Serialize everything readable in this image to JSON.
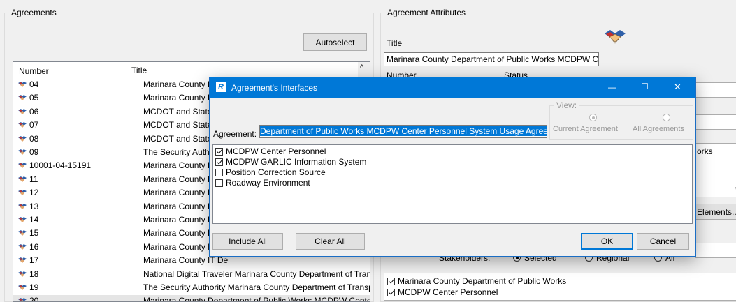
{
  "agreements": {
    "group_label": "Agreements",
    "autoselect_label": "Autoselect",
    "columns": {
      "number": "Number",
      "title": "Title"
    },
    "rows": [
      {
        "number": "04",
        "title": "Marinara County Depa"
      },
      {
        "number": "05",
        "title": "Marinara County Depa"
      },
      {
        "number": "06",
        "title": "MCDOT and State High"
      },
      {
        "number": "07",
        "title": "MCDOT and State High"
      },
      {
        "number": "08",
        "title": "MCDOT and State High"
      },
      {
        "number": "09",
        "title": "The Security Authority"
      },
      {
        "number": "10001-04-15191",
        "title": "Marinara County FMC"
      },
      {
        "number": "11",
        "title": "Marinara County Depa"
      },
      {
        "number": "12",
        "title": "Marinara County Depa"
      },
      {
        "number": "13",
        "title": "Marinara County Depa"
      },
      {
        "number": "14",
        "title": "Marinara County Depa"
      },
      {
        "number": "15",
        "title": "Marinara County Depa"
      },
      {
        "number": "16",
        "title": "Marinara County IT De"
      },
      {
        "number": "17",
        "title": "Marinara County IT De"
      },
      {
        "number": "18",
        "title": "National Digital Traveler Marinara County Department of Transpor"
      },
      {
        "number": "19",
        "title": "The Security Authority Marinara County Department of Transporta"
      },
      {
        "number": "20",
        "title": "Marinara County Department of Public Works MCDPW Center Pers"
      }
    ]
  },
  "attributes": {
    "group_label": "Agreement Attributes",
    "title_label": "Title",
    "title_value": "Marinara County Department of Public Works MCDPW Center",
    "number_label": "Number",
    "status_label": "Status",
    "elements_button": "Elements...",
    "partial_text": "orks",
    "stakeholders_label": "Stakeholders:",
    "selected_label": "Selected",
    "regional_label": "Regional",
    "all_label": "All",
    "stakeholder_items": [
      {
        "label": "Marinara County Department of Public Works",
        "checked": true
      },
      {
        "label": "MCDPW Center Personnel",
        "checked": true
      }
    ]
  },
  "dialog": {
    "title": "Agreement's Interfaces",
    "agreement_label": "Agreement:",
    "agreement_value": " Department of Public Works MCDPW Center Personnel System Usage Agreement",
    "view_label": "View:",
    "view_current": "Current Agreement",
    "view_all": "All Agreements",
    "interfaces": [
      {
        "label": "MCDPW Center Personnel",
        "checked": true
      },
      {
        "label": "MCDPW GARLIC Information System",
        "checked": true
      },
      {
        "label": "Position Correction Source",
        "checked": false
      },
      {
        "label": "Roadway Environment",
        "checked": false
      }
    ],
    "include_all": "Include All",
    "clear_all": "Clear All",
    "ok": "OK",
    "cancel": "Cancel",
    "minimize_glyph": "—",
    "maximize_glyph": "☐",
    "close_glyph": "✕",
    "app_icon_letter": "R"
  }
}
